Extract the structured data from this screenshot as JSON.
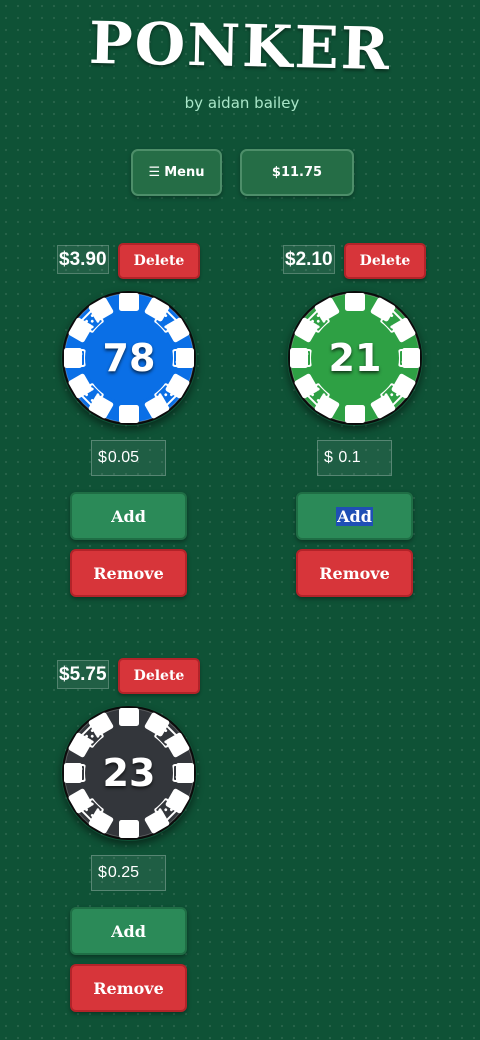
{
  "header": {
    "title": "PONKER",
    "byline": "by aidan bailey"
  },
  "toolbar": {
    "menu_icon": "hamburger-icon",
    "menu_glyph": "☰",
    "menu_label": "Menu",
    "total_label": "$11.75"
  },
  "chips": [
    {
      "value_label": "$3.90",
      "delete_label": "Delete",
      "count": "78",
      "color": "#0a6fe6",
      "amount_prefix": "$",
      "amount_value": "0.05",
      "add_label": "Add",
      "remove_label": "Remove"
    },
    {
      "value_label": "$2.10",
      "delete_label": "Delete",
      "count": "21",
      "color": "#2ea044",
      "amount_prefix": "$",
      "amount_value": " 0.1",
      "add_label": "Add",
      "remove_label": "Remove"
    },
    {
      "value_label": "$5.75",
      "delete_label": "Delete",
      "count": "23",
      "color": "#33363b",
      "amount_prefix": "$",
      "amount_value": "0.25",
      "add_label": "Add",
      "remove_label": "Remove"
    }
  ],
  "colors": {
    "felt": "#0f5236",
    "add_green": "#2b8a58",
    "danger_red": "#d7353a"
  },
  "icons": {
    "chip_edge": "die-icon"
  }
}
